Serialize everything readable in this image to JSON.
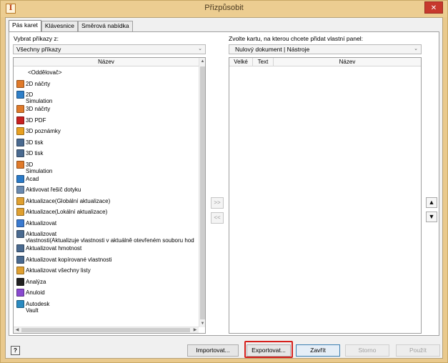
{
  "window": {
    "title": "Přizpůsobit",
    "close_glyph": "✕",
    "app_icon": "I"
  },
  "tabs": [
    {
      "label": "Pás karet",
      "active": true
    },
    {
      "label": "Klávesnice",
      "active": false
    },
    {
      "label": "Směrová nabídka",
      "active": false
    }
  ],
  "left": {
    "label": "Vybrat příkazy z:",
    "combo_value": "Všechny příkazy",
    "column_header": "Název",
    "items": [
      {
        "label": "<Oddělovač>",
        "icon": "separator",
        "color": ""
      },
      {
        "label": "2D náčrty",
        "icon": "sketch-2d-icon",
        "color": "#e07a2a"
      },
      {
        "label": "2D",
        "label2": "Simulation",
        "icon": "simulation-2d-icon",
        "color": "#2f7fc8"
      },
      {
        "label": "3D náčrty",
        "icon": "sketch-3d-icon",
        "color": "#e07a2a"
      },
      {
        "label": "3D PDF",
        "icon": "pdf-icon",
        "color": "#c82020"
      },
      {
        "label": "3D poznámky",
        "icon": "annotation-icon",
        "color": "#e8a020"
      },
      {
        "label": "3D tisk",
        "icon": "printer-3d-icon",
        "color": "#4a6a90"
      },
      {
        "label": "3D tisk",
        "icon": "printer-3d-icon",
        "color": "#4a6a90"
      },
      {
        "label": "3D",
        "label2": "Simulation",
        "icon": "simulation-3d-icon",
        "color": "#e07a2a"
      },
      {
        "label": "Acad",
        "icon": "acad-icon",
        "color": "#2a7ac8"
      },
      {
        "label": "Aktivovat řešič dotyku",
        "icon": "contact-solver-icon",
        "color": "#6a8ab0"
      },
      {
        "label": "Aktualizace(Globální aktualizace)",
        "icon": "global-update-icon",
        "color": "#e0a030"
      },
      {
        "label": "Aktualizace(Lokální aktualizace)",
        "icon": "local-update-icon",
        "color": "#e0a030"
      },
      {
        "label": "Aktualizovat",
        "icon": "update-icon",
        "color": "#3a7ad0"
      },
      {
        "label": "Aktualizovat",
        "label2": "vlastnosti(Aktualizuje vlastnosti v aktuálně otevřeném souboru hod",
        "icon": "update-properties-icon",
        "color": "#4a6a90"
      },
      {
        "label": "Aktualizovat hmotnost",
        "icon": "update-mass-icon",
        "color": "#4a6a90"
      },
      {
        "label": "Aktualizovat kopírované vlastnosti",
        "icon": "copied-properties-icon",
        "color": "#4a6a90"
      },
      {
        "label": "Aktualizovat všechny listy",
        "icon": "update-sheets-icon",
        "color": "#e0a030"
      },
      {
        "label": "Analýza",
        "icon": "analysis-icon",
        "color": "#222222"
      },
      {
        "label": "Anuloid",
        "icon": "torus-icon",
        "color": "#8a4ad0"
      },
      {
        "label": "Autodesk",
        "label2": "Vault",
        "icon": "vault-icon",
        "color": "#2a8ac0"
      }
    ]
  },
  "right": {
    "label": "Zvolte kartu, na kterou chcete přidat vlastní panel:",
    "combo_value": "Nulový dokument | Nástroje",
    "columns": [
      "Velké",
      "Text",
      "Název"
    ]
  },
  "mid": {
    "add": ">>",
    "remove": "<<"
  },
  "side": {
    "up": "▲",
    "down": "▼"
  },
  "footer": {
    "help": "?",
    "import": "Importovat...",
    "export": "Exportovat...",
    "close": "Zavřít",
    "cancel": "Storno",
    "apply": "Použít"
  }
}
